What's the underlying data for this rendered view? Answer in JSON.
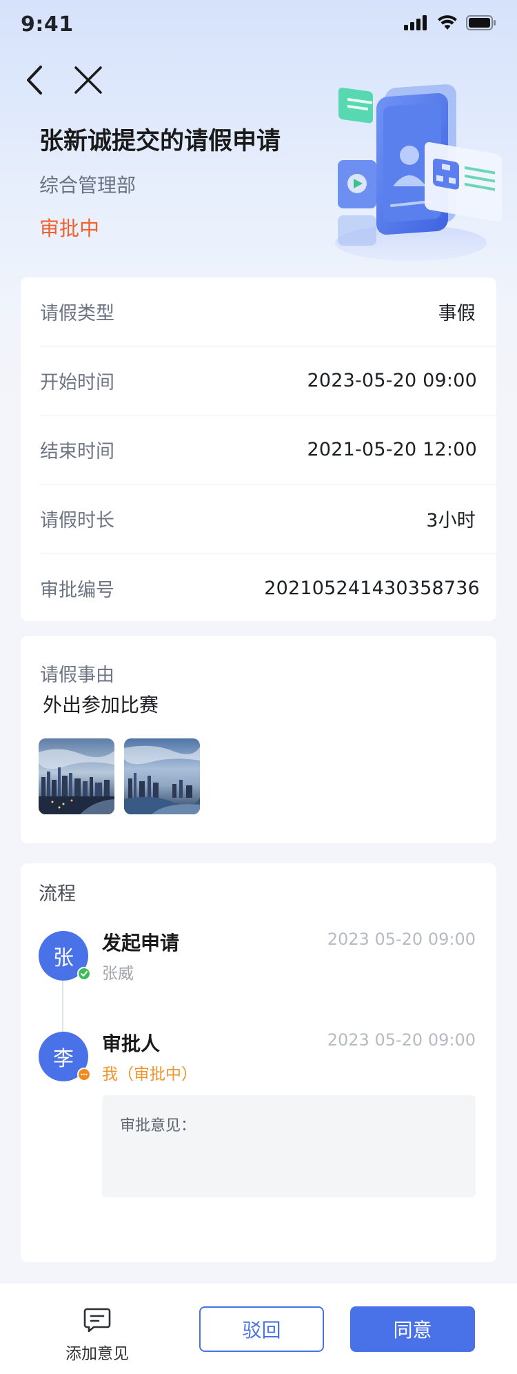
{
  "status_bar": {
    "time": "9:41"
  },
  "header": {
    "title": "张新诚提交的请假申请",
    "department": "综合管理部",
    "status": "审批中",
    "status_color": "#f0612e"
  },
  "details": [
    {
      "label": "请假类型",
      "value": "事假"
    },
    {
      "label": "开始时间",
      "value": "2023-05-20  09:00"
    },
    {
      "label": "结束时间",
      "value": "2021-05-20  12:00"
    },
    {
      "label": "请假时长",
      "value": "3小时"
    },
    {
      "label": "审批编号",
      "value": "202105241430358736"
    }
  ],
  "reason": {
    "label": "请假事由",
    "text": "外出参加比赛"
  },
  "flow": {
    "title": "流程",
    "steps": [
      {
        "avatar_text": "张",
        "name": "发起申请",
        "person": "张威",
        "time": "2023 05-20 09:00",
        "badge": "check-icon",
        "badge_color": "#3dbd5a"
      },
      {
        "avatar_text": "李",
        "name": "审批人",
        "person": "我（审批中）",
        "time": "2023 05-20 09:00",
        "badge": "more-icon",
        "badge_color": "#f08a1e"
      }
    ],
    "comment_label": "审批意见："
  },
  "bottom_bar": {
    "add_comment_label": "添加意见",
    "reject_label": "驳回",
    "agree_label": "同意"
  },
  "colors": {
    "primary": "#4a72e8",
    "accent_orange": "#f0952e"
  }
}
